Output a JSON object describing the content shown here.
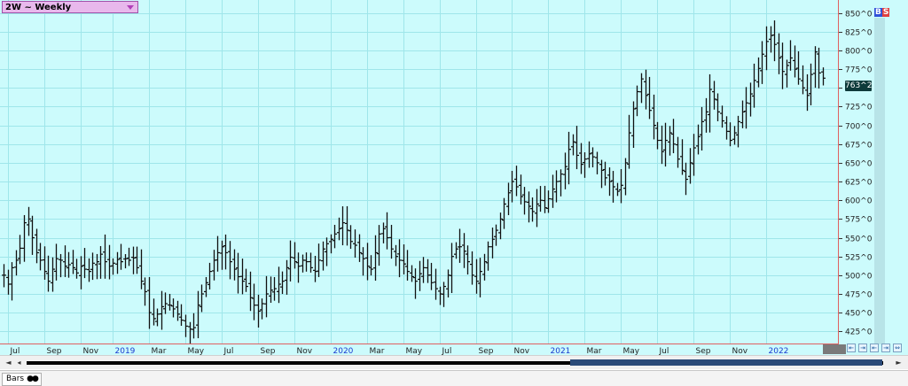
{
  "symbol": {
    "label": "2W ~ Weekly"
  },
  "badges": {
    "b": "B",
    "s": "S"
  },
  "last_price_label": "763^2",
  "status": {
    "tab_label": "Bars",
    "tab_icon": "●●"
  },
  "colors": {
    "background": "#ccfbfc",
    "grid": "#9fe6ea",
    "bars": "#111111",
    "frame": "#e06060",
    "year_label": "#1a3ad0"
  },
  "scroll": {
    "left_icon": "◄",
    "step_icon": "◂",
    "right_icon": "►"
  },
  "chart_data": {
    "type": "ohlc-bar",
    "title": "",
    "xlabel": "",
    "ylabel": "",
    "ylim": [
      410,
      865
    ],
    "yticks": [
      "425^0",
      "450^0",
      "475^0",
      "500^0",
      "525^0",
      "550^0",
      "575^0",
      "600^0",
      "625^0",
      "650^0",
      "675^0",
      "700^0",
      "725^0",
      "750^0",
      "775^0",
      "800^0",
      "825^0",
      "850^0"
    ],
    "ytick_values": [
      425,
      450,
      475,
      500,
      525,
      550,
      575,
      600,
      625,
      650,
      675,
      700,
      725,
      750,
      775,
      800,
      825,
      850
    ],
    "xticks": [
      {
        "label": "Jul",
        "week": 1,
        "year": false
      },
      {
        "label": "Sep",
        "week": 10,
        "year": false
      },
      {
        "label": "Nov",
        "week": 19,
        "year": false
      },
      {
        "label": "2019",
        "week": 27,
        "year": true
      },
      {
        "label": "Mar",
        "week": 36,
        "year": false
      },
      {
        "label": "May",
        "week": 45,
        "year": false
      },
      {
        "label": "Jul",
        "week": 54,
        "year": false
      },
      {
        "label": "Sep",
        "week": 63,
        "year": false
      },
      {
        "label": "Nov",
        "week": 72,
        "year": false
      },
      {
        "label": "2020",
        "week": 81,
        "year": true
      },
      {
        "label": "Mar",
        "week": 90,
        "year": false
      },
      {
        "label": "May",
        "week": 99,
        "year": false
      },
      {
        "label": "Jul",
        "week": 108,
        "year": false
      },
      {
        "label": "Sep",
        "week": 117,
        "year": false
      },
      {
        "label": "Nov",
        "week": 126,
        "year": false
      },
      {
        "label": "2021",
        "week": 135,
        "year": true
      },
      {
        "label": "Mar",
        "week": 144,
        "year": false
      },
      {
        "label": "May",
        "week": 153,
        "year": false
      },
      {
        "label": "Jul",
        "week": 162,
        "year": false
      },
      {
        "label": "Sep",
        "week": 171,
        "year": false
      },
      {
        "label": "Nov",
        "week": 180,
        "year": false
      },
      {
        "label": "2022",
        "week": 189,
        "year": true
      }
    ],
    "series": [
      {
        "closes": [
          500,
          488,
          510,
          520,
          536,
          570,
          575,
          550,
          530,
          520,
          505,
          492,
          508,
          522,
          520,
          512,
          514,
          510,
          503,
          512,
          508,
          505,
          516,
          518,
          528,
          518,
          512,
          516,
          521,
          518,
          522,
          520,
          523,
          510,
          492,
          478,
          450,
          442,
          448,
          458,
          462,
          460,
          455,
          448,
          440,
          432,
          428,
          430,
          460,
          475,
          490,
          505,
          520,
          530,
          538,
          530,
          518,
          508,
          498,
          492,
          485,
          470,
          460,
          452,
          462,
          475,
          480,
          482,
          488,
          492,
          510,
          524,
          518,
          512,
          520,
          518,
          510,
          505,
          520,
          535,
          542,
          548,
          555,
          562,
          570,
          560,
          545,
          540,
          530,
          522,
          512,
          508,
          530,
          555,
          562,
          550,
          535,
          525,
          520,
          515,
          505,
          498,
          492,
          502,
          510,
          500,
          490,
          482,
          475,
          485,
          500,
          525,
          535,
          538,
          532,
          518,
          500,
          492,
          505,
          518,
          538,
          548,
          560,
          575,
          595,
          610,
          625,
          618,
          605,
          598,
          592,
          585,
          595,
          600,
          590,
          602,
          615,
          625,
          635,
          645,
          668,
          678,
          660,
          648,
          655,
          662,
          658,
          650,
          640,
          630,
          625,
          618,
          612,
          620,
          650,
          690,
          722,
          745,
          762,
          740,
          720,
          700,
          680,
          665,
          680,
          690,
          675,
          655,
          640,
          628,
          650,
          670,
          685,
          705,
          718,
          748,
          735,
          718,
          706,
          692,
          680,
          690,
          705,
          718,
          730,
          742,
          760,
          776,
          795,
          812,
          820,
          808,
          790,
          772,
          780,
          790,
          775,
          762,
          750,
          740,
          768,
          798,
          770,
          763
        ]
      }
    ]
  }
}
